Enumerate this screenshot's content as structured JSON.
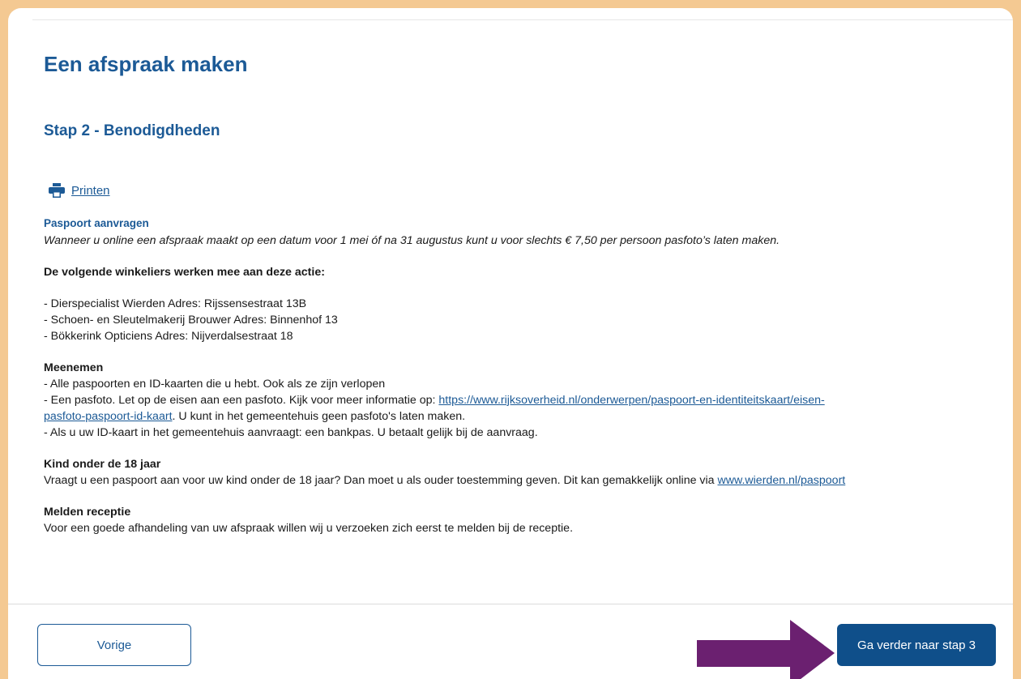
{
  "page": {
    "title": "Een afspraak maken",
    "step_title": "Stap 2 - Benodigdheden",
    "print_label": "Printen"
  },
  "content": {
    "section_heading": "Paspoort aanvragen",
    "intro": "Wanneer u online een afspraak maakt op een datum voor 1 mei óf na 31 augustus kunt u voor slechts € 7,50 per persoon pasfoto’s laten maken.",
    "retailers_heading": "De volgende winkeliers werken mee aan deze actie:",
    "retailers": [
      "- Dierspecialist Wierden Adres: Rijssensestraat 13B",
      "- Schoen- en Sleutelmakerij Brouwer Adres: Binnenhof 13",
      "- Bökkerink Opticiens Adres: Nijverdalsestraat 18"
    ],
    "bring_heading": "Meenemen",
    "bring_line1": "- Alle paspoorten en ID-kaarten die u hebt. Ook als ze zijn verlopen",
    "bring_line2_prefix": "- Een pasfoto. Let op de eisen aan een pasfoto. Kijk voor meer informatie op: ",
    "bring_line2_link_part1": "https://www.rijksoverheid.nl/onderwerpen/paspoort-en-identiteitskaart/eisen-",
    "bring_line2_link_part2": "pasfoto-paspoort-id-kaart",
    "bring_line2_suffix": ". U kunt in het gemeentehuis geen pasfoto's laten maken.",
    "bring_line3": "- Als u uw ID-kaart in het gemeentehuis aanvraagt: een bankpas. U betaalt gelijk bij de aanvraag.",
    "child_heading": "Kind onder de 18 jaar",
    "child_text": "Vraagt u een paspoort aan voor uw kind onder de 18 jaar? Dan moet u als ouder toestemming geven. Dit kan gemakkelijk online via ",
    "child_link": "www.wierden.nl/paspoort",
    "reception_heading": "Melden receptie",
    "reception_text": "Voor een goede afhandeling van uw afspraak willen wij u verzoeken zich eerst te melden bij de receptie."
  },
  "footer": {
    "prev_label": "Vorige",
    "next_label": "Ga verder naar stap 3"
  },
  "colors": {
    "frame": "#f4c992",
    "heading_blue": "#1c5a96",
    "primary_button": "#0f4f8a",
    "arrow": "#6b2070"
  },
  "icons": {
    "print": "printer-icon",
    "annotation": "arrow-right-icon"
  }
}
